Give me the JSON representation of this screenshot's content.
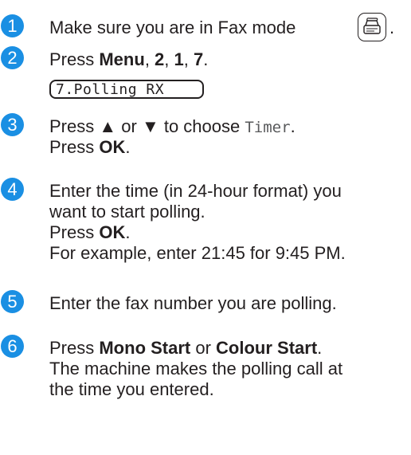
{
  "steps": [
    {
      "n": "1",
      "text": "Make sure you are in Fax mode",
      "after": "."
    },
    {
      "n": "2",
      "pre": "Press ",
      "menu": "Menu",
      "sep1": ", ",
      "k1": "2",
      "sep2": ", ",
      "k2": "1",
      "sep3": ", ",
      "k3": "7",
      "end": "."
    },
    {
      "n": "3",
      "pre": "Press ",
      "up": "▲",
      "mid": " or ",
      "down": "▼",
      "post": " to choose ",
      "option": "Timer",
      "end": ".",
      "line2pre": "Press ",
      "ok": "OK",
      "line2end": "."
    },
    {
      "n": "4",
      "l1": "Enter the time (in 24-hour format) you",
      "l2": "want to start polling.",
      "l3pre": "Press ",
      "ok": "OK",
      "l3end": ".",
      "l4": "For example, enter 21:45 for 9:45 PM."
    },
    {
      "n": "5",
      "text": "Enter the fax number you are polling."
    },
    {
      "n": "6",
      "pre": "Press ",
      "mono": "Mono Start",
      "mid": " or ",
      "colour": "Colour Start",
      "end": ".",
      "l2": "The machine makes the polling call at",
      "l3": "the time you entered."
    }
  ],
  "lcd": {
    "text": "7.Polling RX"
  },
  "icons": {
    "fax_mode": "fax-mode-icon"
  },
  "colors": {
    "accent": "#1a8fe3",
    "text": "#231f20"
  }
}
